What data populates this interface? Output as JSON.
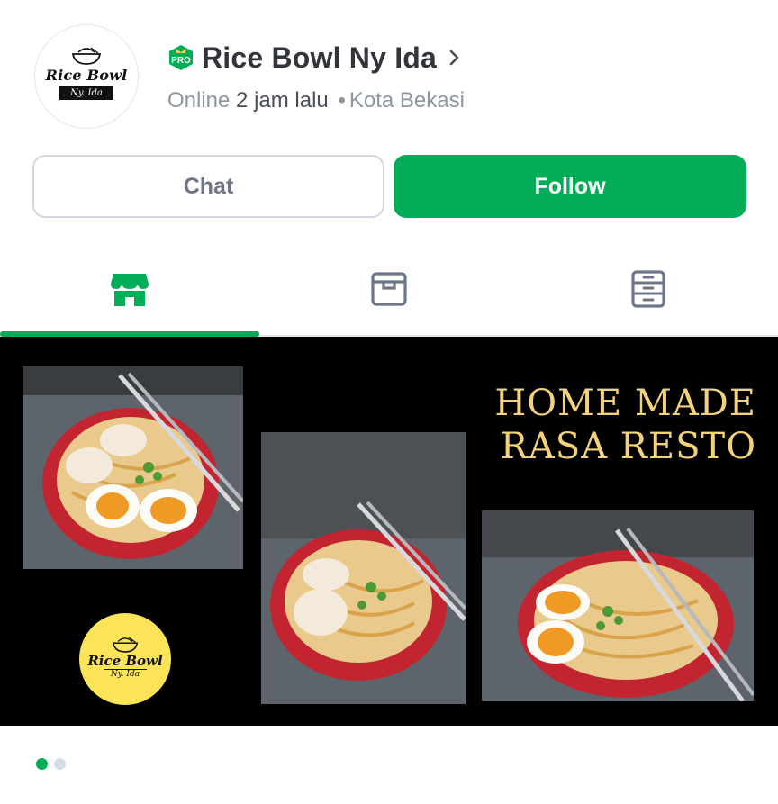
{
  "shop": {
    "name": "Rice Bowl Ny Ida",
    "badge": "PRO",
    "avatar_logo_main": "Rice Bowl",
    "avatar_logo_sub": "Ny. Ida",
    "status_prefix": "Online",
    "status_time": "2 jam lalu",
    "status_separator": "•",
    "location": "Kota Bekasi"
  },
  "actions": {
    "chat_label": "Chat",
    "follow_label": "Follow"
  },
  "tabs": [
    {
      "icon": "storefront-icon",
      "active": true
    },
    {
      "icon": "box-archive-icon",
      "active": false
    },
    {
      "icon": "catalog-list-icon",
      "active": false
    }
  ],
  "banner": {
    "headline_line1": "HOME MADE",
    "headline_line2": "RASA RESTO",
    "badge_logo_main": "Rice Bowl",
    "badge_logo_sub": "Ny. Ida"
  },
  "carousel": {
    "total": 2,
    "active_index": 0
  },
  "colors": {
    "accent": "#03ac56",
    "headline": "#f4d27b",
    "badge_yellow": "#fbe457",
    "text_dark": "#31353b",
    "text_muted": "#8d96a0"
  }
}
